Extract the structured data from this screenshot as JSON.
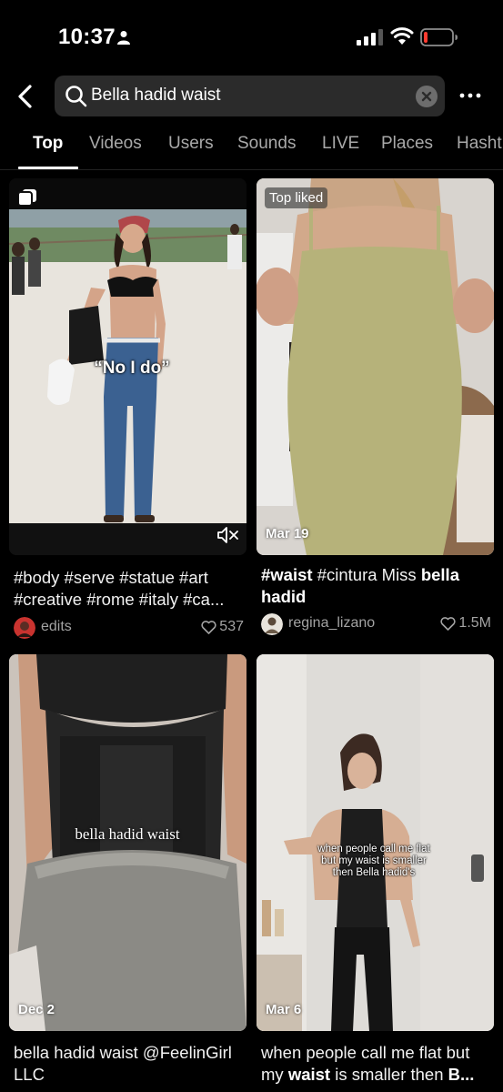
{
  "status_bar": {
    "time": "10:37",
    "icons": [
      "person-icon",
      "signal-icon",
      "wifi-icon",
      "battery-low-icon"
    ],
    "battery_color": "#ff3b30"
  },
  "search": {
    "query": "Bella hadid waist",
    "icons": [
      "back-icon",
      "search-icon",
      "clear-icon",
      "more-icon"
    ]
  },
  "tabs": [
    {
      "label": "Top",
      "active": true
    },
    {
      "label": "Videos"
    },
    {
      "label": "Users"
    },
    {
      "label": "Sounds"
    },
    {
      "label": "LIVE"
    },
    {
      "label": "Places"
    },
    {
      "label": "Hasht"
    }
  ],
  "results": [
    {
      "badge": "",
      "overlay_text": "“No I do”",
      "caption": "#body #serve #statue #art #creative #rome #italy #ca...",
      "author": "edits",
      "likes": "537",
      "icon": "photo-carousel-icon",
      "muted_icon": "muted-speaker-icon"
    },
    {
      "badge": "Top liked",
      "date": "Mar 19",
      "caption_parts": [
        "#waist",
        " #cintura Miss ",
        "bella hadid"
      ],
      "author": "regina_lizano",
      "likes": "1.5M"
    },
    {
      "date": "Dec 2",
      "overlay_text": "bella hadid waist",
      "caption": "bella hadid waist @FeelinGirl LLC"
    },
    {
      "date": "Mar 6",
      "overlay_text": "when people call me flat but my waist is smaller then Bella hadid's",
      "caption_parts": [
        "when people call me flat but my ",
        "waist",
        " is smaller then ",
        "B..."
      ]
    }
  ],
  "colors": {
    "background": "#000000",
    "search_bg": "#2b2b2b",
    "tab_inactive": "#a9a9a9",
    "meta_text": "#a3a3a3"
  }
}
